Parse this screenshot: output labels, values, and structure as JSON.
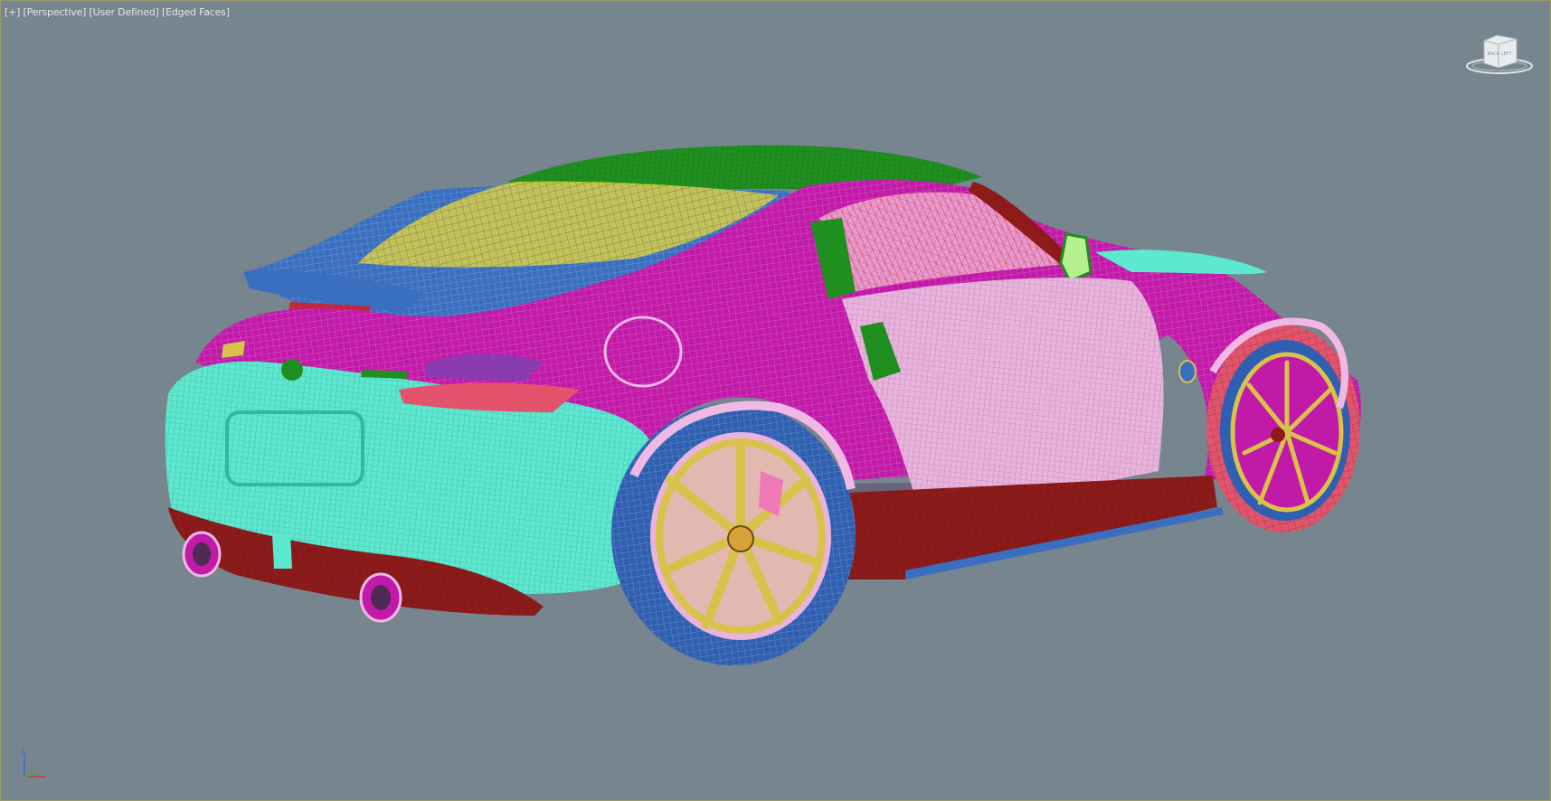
{
  "viewport": {
    "label_parts": [
      "[+]",
      "[Perspective]",
      "[User Defined]",
      "[Edged Faces]"
    ],
    "background": "#77858e"
  },
  "viewcube": {
    "face_label": "BACK  LEFT",
    "icon": "viewcube-icon"
  },
  "axis_tripod": {
    "z_label": "z",
    "icon": "axis-tripod-icon"
  },
  "model": {
    "icon": "sports-car-wireframe",
    "colors": {
      "body_magenta": "#c21aa8",
      "bumper_cyan": "#5de8d0",
      "roof_green": "#1f8f1f",
      "hatch_blue": "#3a6fc0",
      "door_pink": "#e9b3dd",
      "glass_yellow": "#d9d04a",
      "wheel_gold": "#d8c24a",
      "skirt_red": "#8e1a1a",
      "tire_blue": "#2f5fb0"
    }
  }
}
